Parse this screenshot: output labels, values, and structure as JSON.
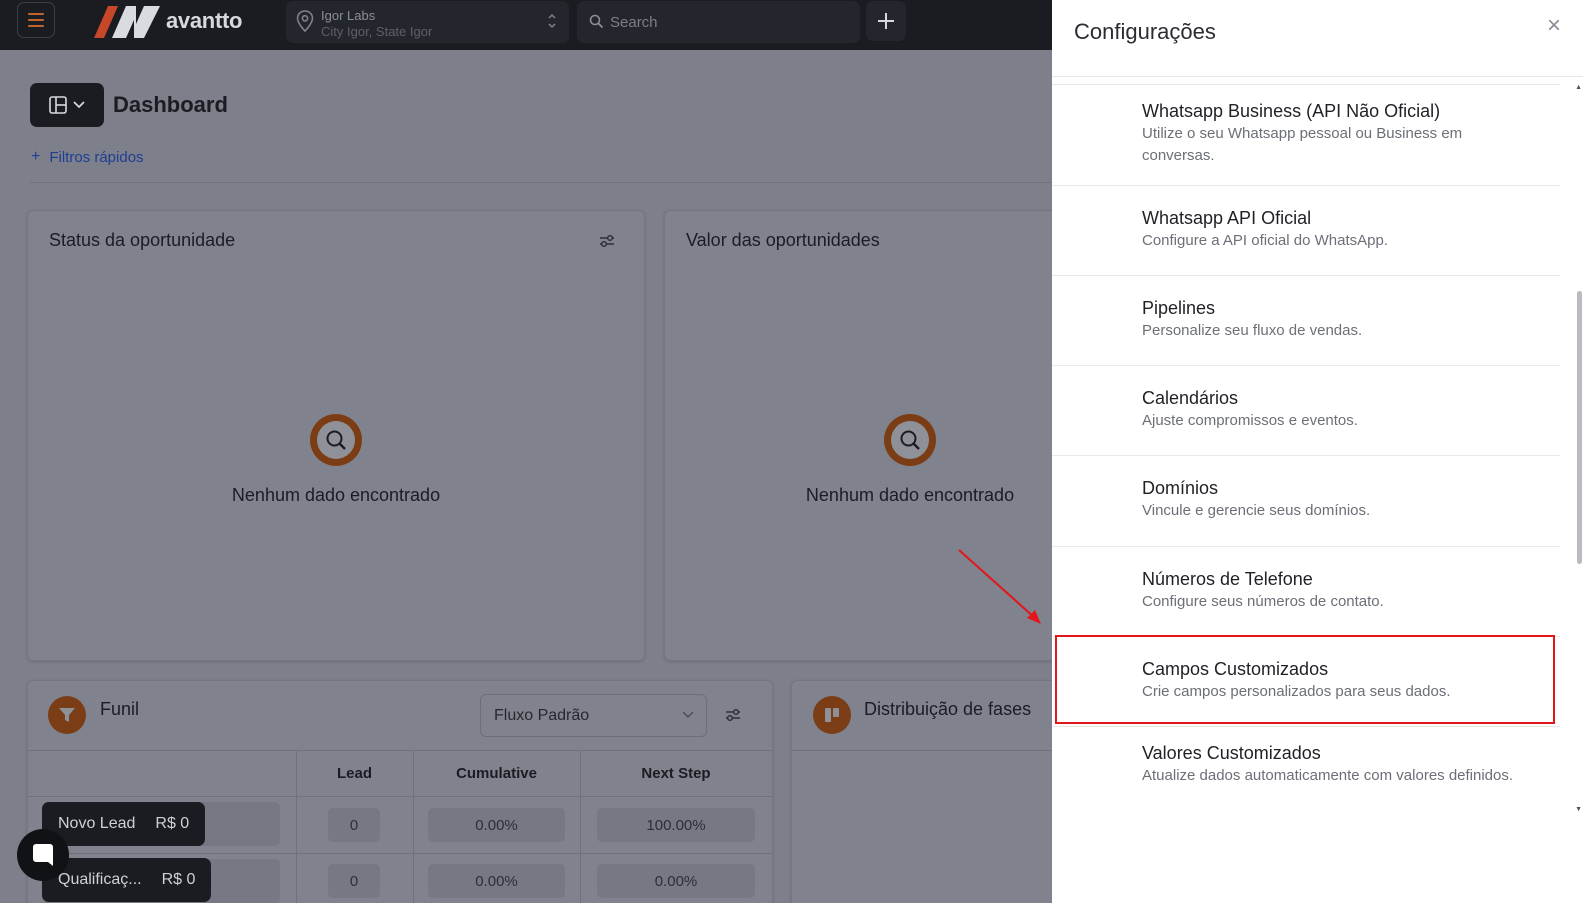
{
  "app": {
    "logo_text": "avantto",
    "location_name": "Igor Labs",
    "location_sub": "City Igor, State Igor",
    "search_placeholder": "Search"
  },
  "dashboard": {
    "title": "Dashboard",
    "quick_filters_label": "Filtros rápidos",
    "status_card_title": "Status da oportunidade",
    "value_card_title": "Valor das oportunidades",
    "empty_text_1": "Nenhum dado encontrado",
    "empty_text_2": "Nenhum dado encontrado"
  },
  "funnel": {
    "title": "Funil",
    "flow_value": "Fluxo Padrão",
    "columns": [
      "Lead",
      "Cumulative",
      "Next Step"
    ],
    "rows": [
      {
        "stage": "Novo Lead",
        "amount": "R$ 0",
        "lead": "0",
        "cumulative": "0.00%",
        "next_step": "100.00%"
      },
      {
        "stage": "Qualificaç...",
        "amount": "R$ 0",
        "lead": "0",
        "cumulative": "0.00%",
        "next_step": "0.00%"
      }
    ]
  },
  "distribution": {
    "title": "Distribuição de fases"
  },
  "settings_panel": {
    "title": "Configurações",
    "close_label": "×",
    "items": [
      {
        "title": "Whatsapp Business (API Não Oficial)",
        "desc": "Utilize o seu Whatsapp pessoal ou Business em conversas."
      },
      {
        "title": "Whatsapp API Oficial",
        "desc": "Configure a API oficial do WhatsApp."
      },
      {
        "title": "Pipelines",
        "desc": "Personalize seu fluxo de vendas."
      },
      {
        "title": "Calendários",
        "desc": "Ajuste compromissos e eventos."
      },
      {
        "title": "Domínios",
        "desc": "Vincule e gerencie seus domínios."
      },
      {
        "title": "Números de Telefone",
        "desc": "Configure seus números de contato."
      },
      {
        "title": "Campos Customizados",
        "desc": "Crie campos personalizados para seus dados."
      },
      {
        "title": "Valores Customizados",
        "desc": "Atualize dados automaticamente com valores definidos."
      }
    ]
  },
  "colors": {
    "accent": "#c3652a",
    "annotation": "#e3161b",
    "topbar": "#1a1c22",
    "overlay_bg": "#7d7f8a"
  }
}
